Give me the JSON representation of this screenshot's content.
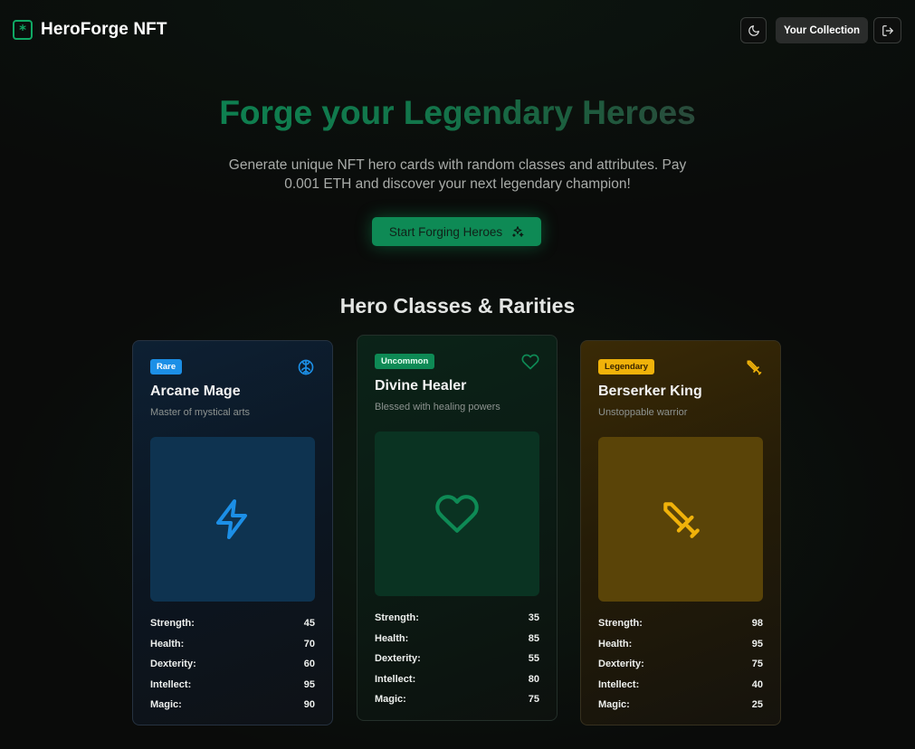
{
  "header": {
    "brand": "HeroForge NFT",
    "logo_icon": "asterisk-logo-icon",
    "theme_icon": "moon-icon",
    "collection_label": "Your Collection",
    "logout_icon": "log-out-icon"
  },
  "hero": {
    "title": "Forge your Legendary Heroes",
    "subtitle": "Generate unique NFT hero cards with random classes and attributes. Pay 0.001 ETH and discover your next legendary champion!",
    "cta_label": "Start Forging Heroes",
    "cta_icon": "sparkles-icon"
  },
  "section": {
    "title": "Hero Classes & Rarities"
  },
  "colors": {
    "accent": "#0e8a55",
    "rare": "#1c8fe6",
    "uncommon": "#0e8a55",
    "legendary": "#f0b20a"
  },
  "cards": [
    {
      "rarity": "Rare",
      "name": "Arcane Mage",
      "description": "Master of mystical arts",
      "corner_icon": "brain-icon",
      "art_icon": "lightning-icon",
      "stats": [
        {
          "label": "Strength:",
          "value": "45"
        },
        {
          "label": "Health:",
          "value": "70"
        },
        {
          "label": "Dexterity:",
          "value": "60"
        },
        {
          "label": "Intellect:",
          "value": "95"
        },
        {
          "label": "Magic:",
          "value": "90"
        }
      ]
    },
    {
      "rarity": "Uncommon",
      "name": "Divine Healer",
      "description": "Blessed with healing powers",
      "corner_icon": "heart-icon",
      "art_icon": "heart-icon",
      "stats": [
        {
          "label": "Strength:",
          "value": "35"
        },
        {
          "label": "Health:",
          "value": "85"
        },
        {
          "label": "Dexterity:",
          "value": "55"
        },
        {
          "label": "Intellect:",
          "value": "80"
        },
        {
          "label": "Magic:",
          "value": "75"
        }
      ]
    },
    {
      "rarity": "Legendary",
      "name": "Berserker King",
      "description": "Unstoppable warrior",
      "corner_icon": "sword-icon",
      "art_icon": "sword-icon",
      "stats": [
        {
          "label": "Strength:",
          "value": "98"
        },
        {
          "label": "Health:",
          "value": "95"
        },
        {
          "label": "Dexterity:",
          "value": "75"
        },
        {
          "label": "Intellect:",
          "value": "40"
        },
        {
          "label": "Magic:",
          "value": "25"
        }
      ]
    }
  ]
}
